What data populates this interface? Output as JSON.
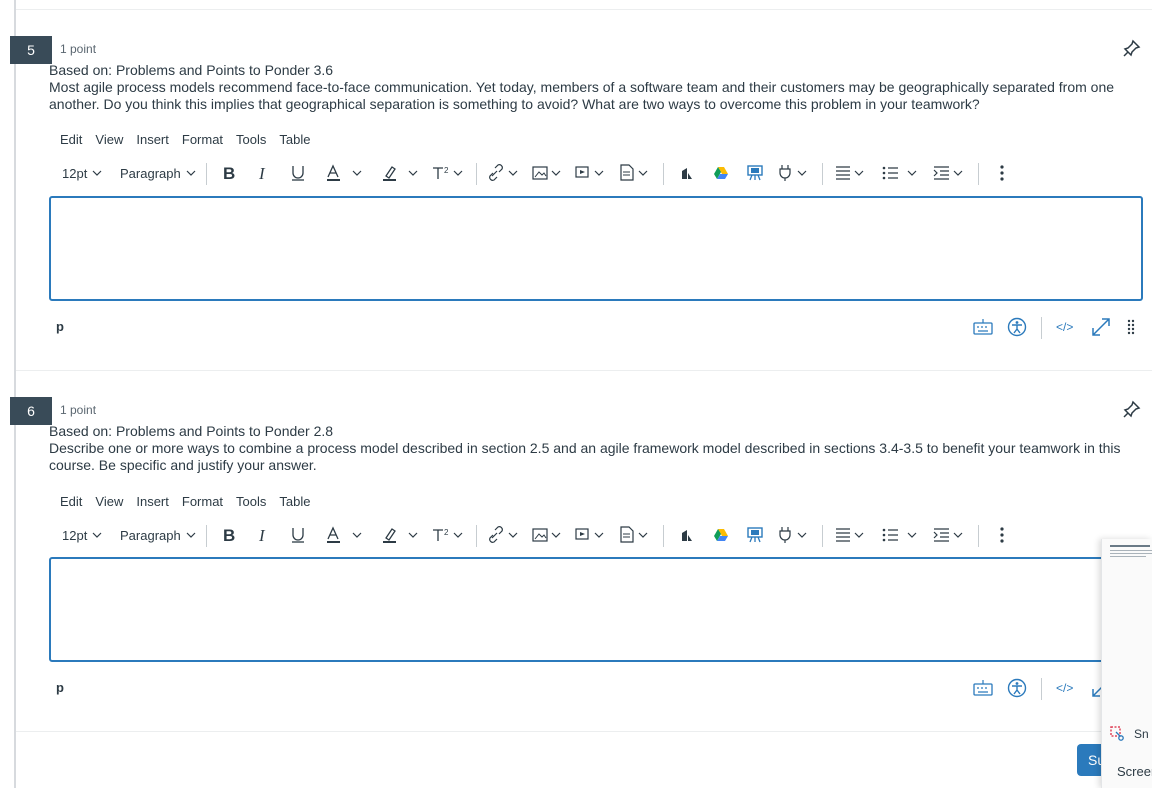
{
  "questions": [
    {
      "number": "5",
      "points": "1 point",
      "based_on": "Based on: Problems and Points to Ponder 3.6",
      "text": "Most agile process models recommend face-to-face communication. Yet today, members of a software team and their customers may be geographically separated from one another. Do you think this implies that geographical separation is something to avoid? What are two ways  to overcome this problem in your teamwork?",
      "status_path": "p"
    },
    {
      "number": "6",
      "points": "1 point",
      "based_on": "Based on: Problems and Points to Ponder 2.8",
      "text": "Describe one or more ways to combine a process model described in section 2.5 and an agile framework model described in sections 3.4-3.5 to benefit your teamwork in this course. Be specific and justify your answer.",
      "status_path": "p"
    }
  ],
  "editor": {
    "menu": [
      "Edit",
      "View",
      "Insert",
      "Format",
      "Tools",
      "Table"
    ],
    "font_size": "12pt",
    "block_format": "Paragraph",
    "code_view_label": "</>"
  },
  "side_panel": {
    "snip_label": "Sn",
    "screen_label": "Screer",
    "submit_label": "Su"
  },
  "colors": {
    "accent": "#2b7abc",
    "qnum_bg": "#394b58"
  }
}
